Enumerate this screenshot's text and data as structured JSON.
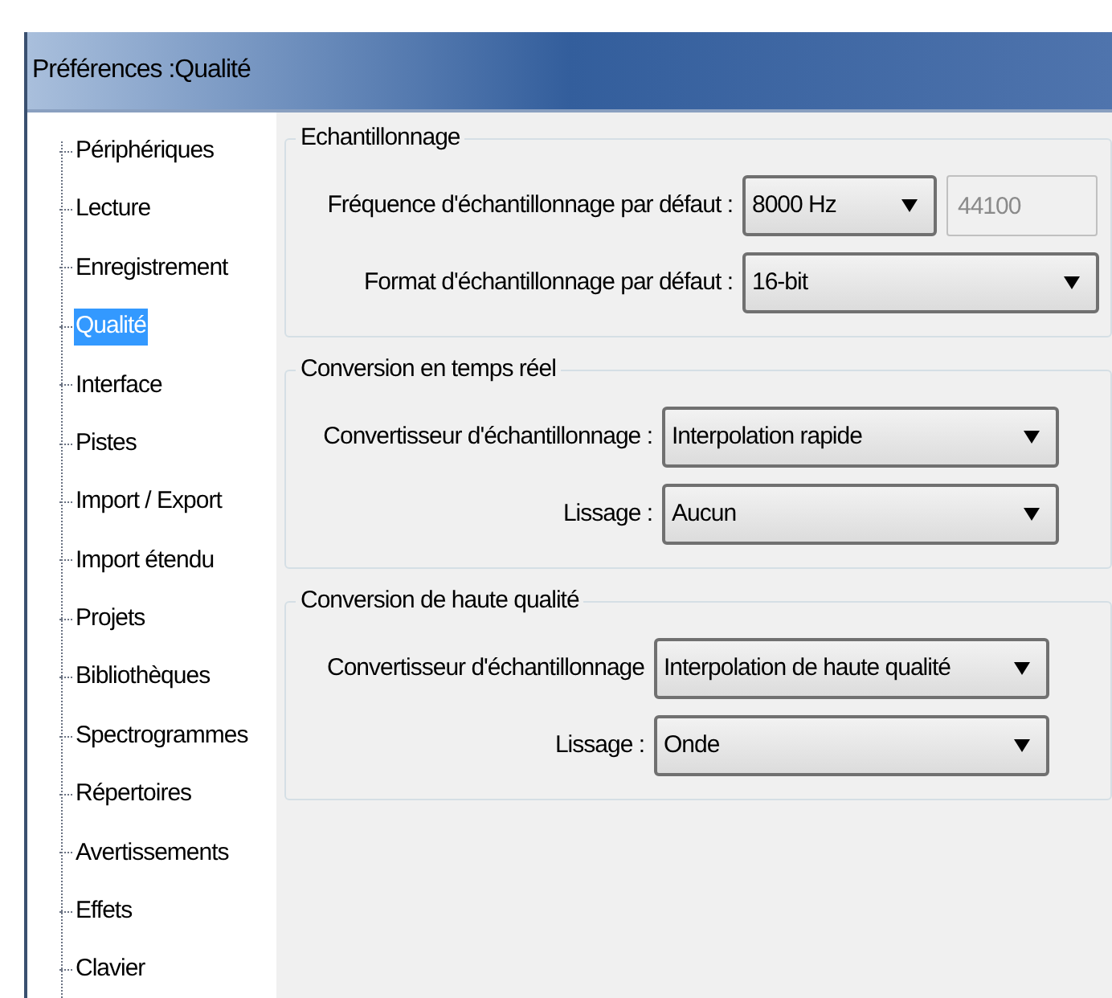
{
  "window": {
    "title": "Préférences :Qualité"
  },
  "tree": {
    "items": [
      {
        "label": "Périphériques",
        "selected": false
      },
      {
        "label": "Lecture",
        "selected": false
      },
      {
        "label": "Enregistrement",
        "selected": false
      },
      {
        "label": "Qualité",
        "selected": true
      },
      {
        "label": "Interface",
        "selected": false
      },
      {
        "label": "Pistes",
        "selected": false
      },
      {
        "label": "Import / Export",
        "selected": false
      },
      {
        "label": "Import étendu",
        "selected": false
      },
      {
        "label": "Projets",
        "selected": false
      },
      {
        "label": "Bibliothèques",
        "selected": false
      },
      {
        "label": "Spectrogrammes",
        "selected": false
      },
      {
        "label": "Répertoires",
        "selected": false
      },
      {
        "label": "Avertissements",
        "selected": false
      },
      {
        "label": "Effets",
        "selected": false
      },
      {
        "label": "Clavier",
        "selected": false
      }
    ]
  },
  "groups": [
    {
      "title": "Echantillonnage",
      "rows": [
        {
          "label": "Fréquence d'échantillonnage par défaut :",
          "value": "8000 Hz",
          "number_field": {
            "value": "44100",
            "disabled": true
          }
        },
        {
          "label": "Format d'échantillonnage par défaut :",
          "value": "16-bit"
        }
      ]
    },
    {
      "title": "Conversion en temps réel",
      "rows": [
        {
          "label": "Convertisseur d'échantillonnage :",
          "value": "Interpolation rapide"
        },
        {
          "label": "Lissage :",
          "value": "Aucun"
        }
      ]
    },
    {
      "title": "Conversion de haute qualité",
      "rows": [
        {
          "label": "Convertisseur d'échantillonnage",
          "value": "Interpolation de haute qualité"
        },
        {
          "label": "Lissage :",
          "value": "Onde"
        }
      ]
    }
  ]
}
